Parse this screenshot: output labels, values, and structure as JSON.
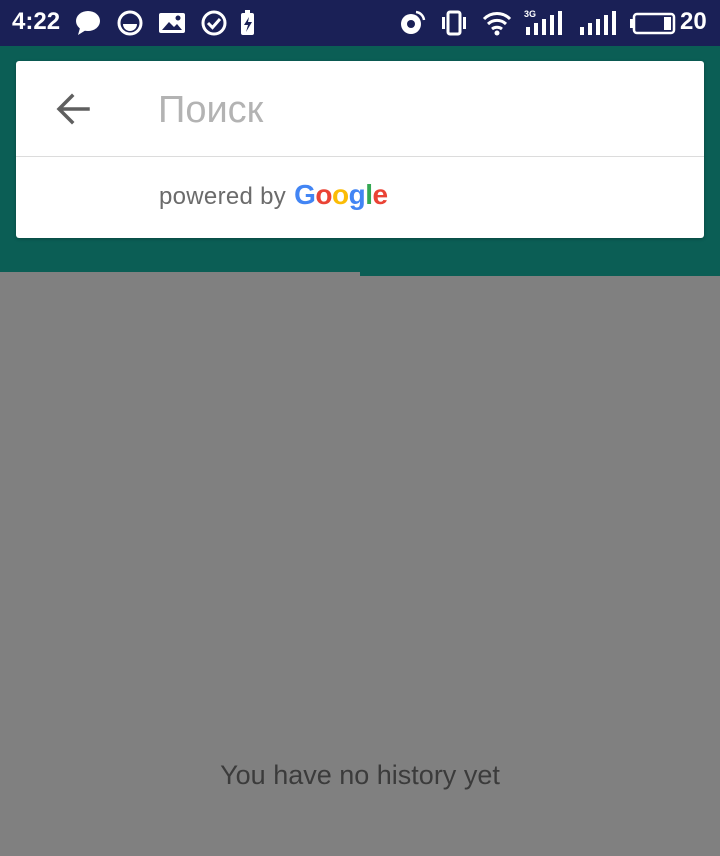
{
  "status_bar": {
    "time": "4:22",
    "battery_percent": "20",
    "network_label": "3G",
    "left_icons": [
      "chat-bubble-icon",
      "circle-icon",
      "image-notification-icon",
      "check-circle-icon",
      "battery-charging-icon"
    ],
    "right_icons": [
      "hotspot-icon",
      "vibrate-icon",
      "wifi-icon",
      "signal-3g-icon",
      "signal-icon",
      "battery-icon"
    ]
  },
  "search": {
    "placeholder": "Поиск",
    "value": "",
    "back_icon": "arrow-back-icon"
  },
  "attribution": {
    "powered_by": "powered by",
    "brand": "Google"
  },
  "content": {
    "empty_message": "You have no history yet"
  },
  "colors": {
    "status_bar": "#1a2056",
    "app_bar": "#0b5e55",
    "overlay": "#808080",
    "card": "#ffffff"
  }
}
